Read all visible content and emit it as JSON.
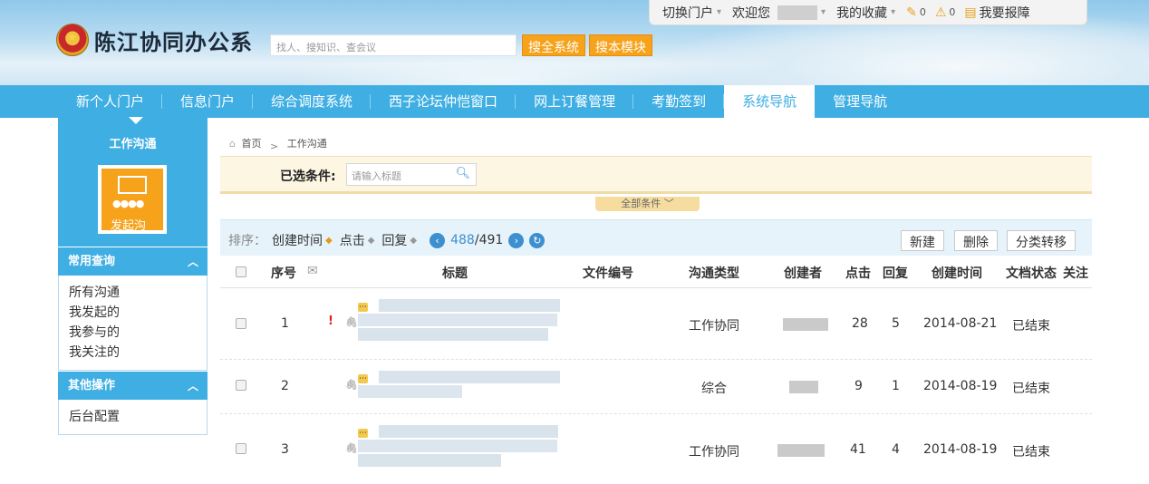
{
  "header": {
    "logo_text": "陈江协同办公系",
    "search_placeholder": "找人、搜知识、查会议",
    "btn_search_all": "搜全系统",
    "btn_search_module": "搜本模块"
  },
  "topbar": {
    "switch_portal": "切换门户",
    "welcome": "欢迎您",
    "favorites": "我的收藏",
    "edit_count": "0",
    "warn_count": "0",
    "report": "我要报障"
  },
  "nav": {
    "items": [
      {
        "label": "新个人门户",
        "active": false
      },
      {
        "label": "信息门户",
        "active": false
      },
      {
        "label": "综合调度系统",
        "active": false
      },
      {
        "label": "西子论坛仲恺窗口",
        "active": false
      },
      {
        "label": "网上订餐管理",
        "active": false
      },
      {
        "label": "考勤签到",
        "active": false
      },
      {
        "label": "系统导航",
        "active": true
      },
      {
        "label": "管理导航",
        "active": false
      }
    ]
  },
  "sidebar": {
    "title": "工作沟通",
    "tile_label": "发起沟",
    "section1": "常用查询",
    "links1": [
      "所有沟通",
      "我发起的",
      "我参与的",
      "我关注的"
    ],
    "section2": "其他操作",
    "links2": [
      "后台配置"
    ]
  },
  "breadcrumb": {
    "home": "首页",
    "current": "工作沟通"
  },
  "filter": {
    "label": "已选条件:",
    "placeholder": "请输入标题",
    "all_conditions": "全部条件"
  },
  "toolbar": {
    "sort_prefix": "排序：",
    "sort_created": "创建时间",
    "sort_clicks": "点击",
    "sort_replies": "回复",
    "page_current": "488",
    "page_sep": " / ",
    "page_total": "491",
    "btn_new": "新建",
    "btn_delete": "删除",
    "btn_move": "分类转移"
  },
  "table": {
    "headers": {
      "no": "序号",
      "title": "标题",
      "doc_no": "文件编号",
      "type": "沟通类型",
      "creator": "创建者",
      "clicks": "点击",
      "replies": "回复",
      "created": "创建时间",
      "status": "文档状态",
      "follow": "关注"
    },
    "rows": [
      {
        "no": "1",
        "type": "工作协同",
        "clicks": "28",
        "replies": "5",
        "created": "2014-08-21",
        "status": "已结束",
        "important": "!"
      },
      {
        "no": "2",
        "type": "综合",
        "clicks": "9",
        "replies": "1",
        "created": "2014-08-19",
        "status": "已结束",
        "important": ""
      },
      {
        "no": "3",
        "type": "工作协同",
        "clicks": "41",
        "replies": "4",
        "created": "2014-08-19",
        "status": "已结束",
        "important": ""
      }
    ]
  },
  "colors": {
    "nav_blue": "#3eaee3",
    "orange": "#f7a21b",
    "link_blue": "#3e8fd0"
  }
}
